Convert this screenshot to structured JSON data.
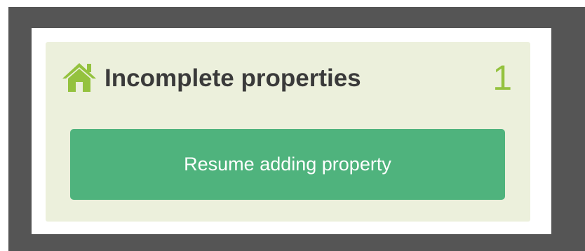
{
  "card": {
    "icon": "home-icon",
    "title": "Incomplete properties",
    "count": "1",
    "button_label": "Resume adding property"
  },
  "colors": {
    "frame_background": "#555555",
    "card_background": "#ecf0dc",
    "accent_green": "#94c23e",
    "button_green": "#4fb37d"
  }
}
